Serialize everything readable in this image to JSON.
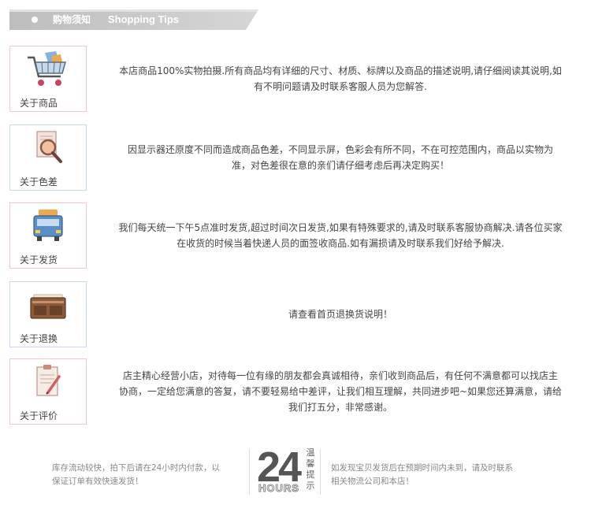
{
  "header": {
    "title_zh": "购物须知",
    "title_en": "Shopping Tips"
  },
  "colors": {
    "banner": "#cccccc",
    "border_pink": "#f2c8d0",
    "border_blue": "#c9d9ef",
    "text": "#444444",
    "footer_text": "#888888"
  },
  "rows": [
    {
      "icon": "shopping-cart-icon",
      "label": "关于商品",
      "lines": [
        "本店商品100%实物拍摄.所有商品均有详细的尺寸、材质、标牌以及商品的描述说明,请仔细阅读其说明,如",
        "有不明问题请及时联系客服人员为您解答."
      ]
    },
    {
      "icon": "magnifier-icon",
      "label": "关于色差",
      "lines": [
        "因显示器还原度不同而造成商品色差，不同显示屏，色彩会有所不同，不在可控范围内，商品以实物为",
        "准，对色差很在意的亲们请仔细考虑后再决定购买！"
      ]
    },
    {
      "icon": "delivery-truck-icon",
      "label": "关于发货",
      "lines": [
        "我们每天统一下午5点准时发货,超过时间次日发货,如果有特殊要求的,请及时联系客服协商解决.请各位买家",
        "在收货的时候当着快递人员的面签收商品.如有漏损请及时联系我们好给予解决."
      ]
    },
    {
      "icon": "wallet-icon",
      "label": "关于退换",
      "lines": [
        "请查看首页退换货说明！"
      ]
    },
    {
      "icon": "clipboard-pen-icon",
      "label": "关于评价",
      "lines": [
        "店主精心经营小店，对待每一位有缘的朋友都会真诚相待，亲们收到商品后，有任何不满意都可以找店主",
        "协商，一定给您满意的答复，请不要轻易给中差评，让我们相互理解，共同进步吧~如果您还算满意，请给",
        "我们打五分，非常感谢。"
      ]
    }
  ],
  "footer": {
    "left_lines": [
      "库存流动较快，拍下后请在24小时内付款，以",
      "保证订单有效快速发货！"
    ],
    "badge_number": "24",
    "badge_hours": "HOURS",
    "badge_vertical": "温馨提示",
    "right_lines": [
      "如发现宝贝发货后在预期时间内未到，请及时联系",
      "相关物流公司和本店！"
    ]
  }
}
